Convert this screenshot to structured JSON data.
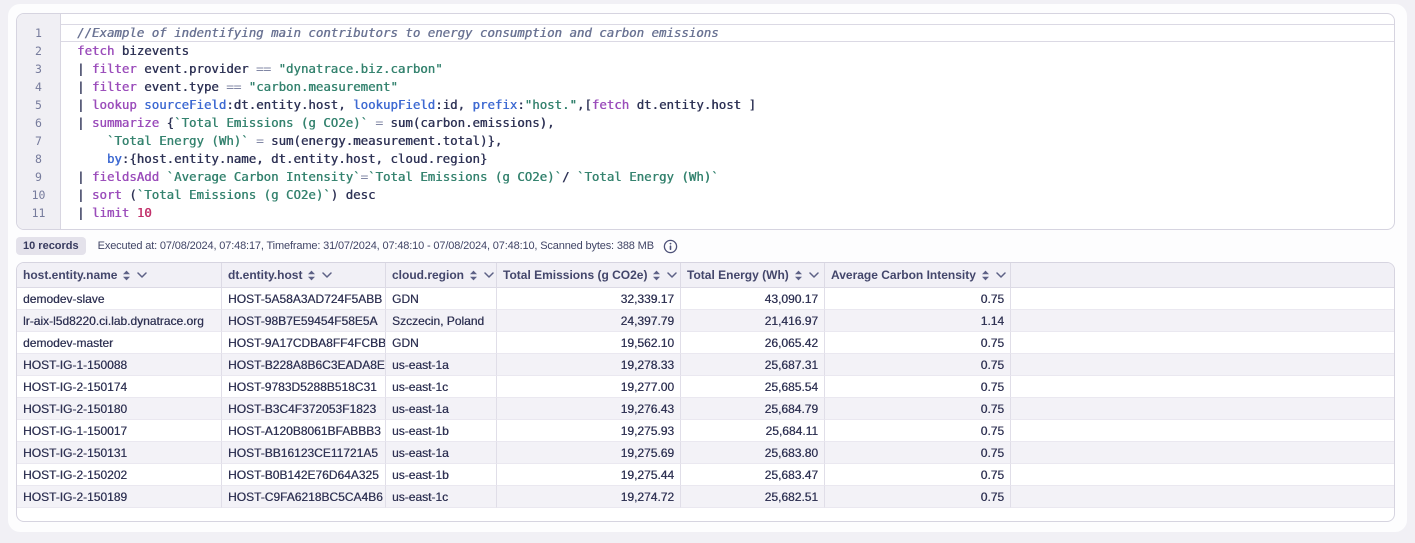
{
  "colors": {
    "page_background": "#f1f0f5",
    "panel_background": "#fdfdfe",
    "border": "#d6d4e0",
    "syntax_keyword": "#9b4dbb",
    "syntax_parameter": "#3e6ad2",
    "syntax_string": "#35836f",
    "syntax_number": "#c2316b",
    "syntax_comment": "#6b7494",
    "row_stripe": "#f3f2f7"
  },
  "editor": {
    "lines": [
      {
        "number": "1",
        "active": true,
        "tokens": [
          [
            "comment",
            "//Example of indentifying main contributors to energy consumption and carbon emissions"
          ]
        ]
      },
      {
        "number": "2",
        "tokens": [
          [
            "keyword",
            "fetch"
          ],
          [
            "plain",
            " bizevents"
          ]
        ]
      },
      {
        "number": "3",
        "tokens": [
          [
            "plain",
            "| "
          ],
          [
            "keyword",
            "filter"
          ],
          [
            "plain",
            " event.provider "
          ],
          [
            "operator",
            "=="
          ],
          [
            "plain",
            " "
          ],
          [
            "string",
            "\"dynatrace.biz.carbon\""
          ]
        ]
      },
      {
        "number": "4",
        "tokens": [
          [
            "plain",
            "| "
          ],
          [
            "keyword",
            "filter"
          ],
          [
            "plain",
            " event.type "
          ],
          [
            "operator",
            "=="
          ],
          [
            "plain",
            " "
          ],
          [
            "string",
            "\"carbon.measurement\""
          ]
        ]
      },
      {
        "number": "5",
        "tokens": [
          [
            "plain",
            "| "
          ],
          [
            "keyword",
            "lookup"
          ],
          [
            "plain",
            " "
          ],
          [
            "param",
            "sourceField"
          ],
          [
            "plain",
            ":dt.entity.host, "
          ],
          [
            "param",
            "lookupField"
          ],
          [
            "plain",
            ":id, "
          ],
          [
            "param",
            "prefix"
          ],
          [
            "plain",
            ":"
          ],
          [
            "string",
            "\"host.\""
          ],
          [
            "plain",
            ",["
          ],
          [
            "keyword",
            "fetch"
          ],
          [
            "plain",
            " dt.entity.host ]"
          ]
        ]
      },
      {
        "number": "6",
        "tokens": [
          [
            "plain",
            "| "
          ],
          [
            "keyword",
            "summarize"
          ],
          [
            "plain",
            " {"
          ],
          [
            "string",
            "`Total Emissions (g CO2e)`"
          ],
          [
            "plain",
            " "
          ],
          [
            "operator",
            "="
          ],
          [
            "plain",
            " sum(carbon.emissions),"
          ]
        ]
      },
      {
        "number": "7",
        "tokens": [
          [
            "plain",
            "    "
          ],
          [
            "string",
            "`Total Energy (Wh)`"
          ],
          [
            "plain",
            " "
          ],
          [
            "operator",
            "="
          ],
          [
            "plain",
            " sum(energy.measurement.total)},"
          ]
        ]
      },
      {
        "number": "8",
        "tokens": [
          [
            "plain",
            "    "
          ],
          [
            "param",
            "by"
          ],
          [
            "plain",
            ":{host.entity.name, dt.entity.host, cloud.region}"
          ]
        ]
      },
      {
        "number": "9",
        "tokens": [
          [
            "plain",
            "| "
          ],
          [
            "keyword",
            "fieldsAdd"
          ],
          [
            "plain",
            " "
          ],
          [
            "string",
            "`Average Carbon Intensity`"
          ],
          [
            "operator",
            "="
          ],
          [
            "string",
            "`Total Emissions (g CO2e)`"
          ],
          [
            "plain",
            "/ "
          ],
          [
            "string",
            "`Total Energy (Wh)`"
          ]
        ]
      },
      {
        "number": "10",
        "tokens": [
          [
            "plain",
            "| "
          ],
          [
            "keyword",
            "sort"
          ],
          [
            "plain",
            " ("
          ],
          [
            "string",
            "`Total Emissions (g CO2e)`"
          ],
          [
            "plain",
            ") desc"
          ]
        ]
      },
      {
        "number": "11",
        "tokens": [
          [
            "plain",
            "| "
          ],
          [
            "keyword",
            "limit"
          ],
          [
            "plain",
            " "
          ],
          [
            "number",
            "10"
          ]
        ]
      }
    ]
  },
  "status": {
    "records_badge": "10 records",
    "meta": "Executed at: 07/08/2024, 07:48:17, Timeframe: 31/07/2024, 07:48:10 - 07/08/2024, 07:48:10, Scanned bytes: 388 MB"
  },
  "table": {
    "columns": [
      {
        "label": "host.entity.name",
        "align": "left"
      },
      {
        "label": "dt.entity.host",
        "align": "left"
      },
      {
        "label": "cloud.region",
        "align": "left"
      },
      {
        "label": "Total Emissions (g CO2e)",
        "align": "right"
      },
      {
        "label": "Total Energy (Wh)",
        "align": "right"
      },
      {
        "label": "Average Carbon Intensity",
        "align": "right"
      }
    ],
    "rows": [
      [
        "demodev-slave",
        "HOST-5A58A3AD724F5ABB",
        "GDN",
        "32,339.17",
        "43,090.17",
        "0.75"
      ],
      [
        "lr-aix-l5d8220.ci.lab.dynatrace.org",
        "HOST-98B7E59454F58E5A",
        "Szczecin, Poland",
        "24,397.79",
        "21,416.97",
        "1.14"
      ],
      [
        "demodev-master",
        "HOST-9A17CDBA8FF4FCBB",
        "GDN",
        "19,562.10",
        "26,065.42",
        "0.75"
      ],
      [
        "HOST-IG-1-150088",
        "HOST-B228A8B6C3EADA8E",
        "us-east-1a",
        "19,278.33",
        "25,687.31",
        "0.75"
      ],
      [
        "HOST-IG-2-150174",
        "HOST-9783D5288B518C31",
        "us-east-1c",
        "19,277.00",
        "25,685.54",
        "0.75"
      ],
      [
        "HOST-IG-2-150180",
        "HOST-B3C4F372053F1823",
        "us-east-1a",
        "19,276.43",
        "25,684.79",
        "0.75"
      ],
      [
        "HOST-IG-1-150017",
        "HOST-A120B8061BFABBB3",
        "us-east-1b",
        "19,275.93",
        "25,684.11",
        "0.75"
      ],
      [
        "HOST-IG-2-150131",
        "HOST-BB16123CE11721A5",
        "us-east-1a",
        "19,275.69",
        "25,683.80",
        "0.75"
      ],
      [
        "HOST-IG-2-150202",
        "HOST-B0B142E76D64A325",
        "us-east-1b",
        "19,275.44",
        "25,683.47",
        "0.75"
      ],
      [
        "HOST-IG-2-150189",
        "HOST-C9FA6218BC5CA4B6",
        "us-east-1c",
        "19,274.72",
        "25,682.51",
        "0.75"
      ]
    ]
  }
}
